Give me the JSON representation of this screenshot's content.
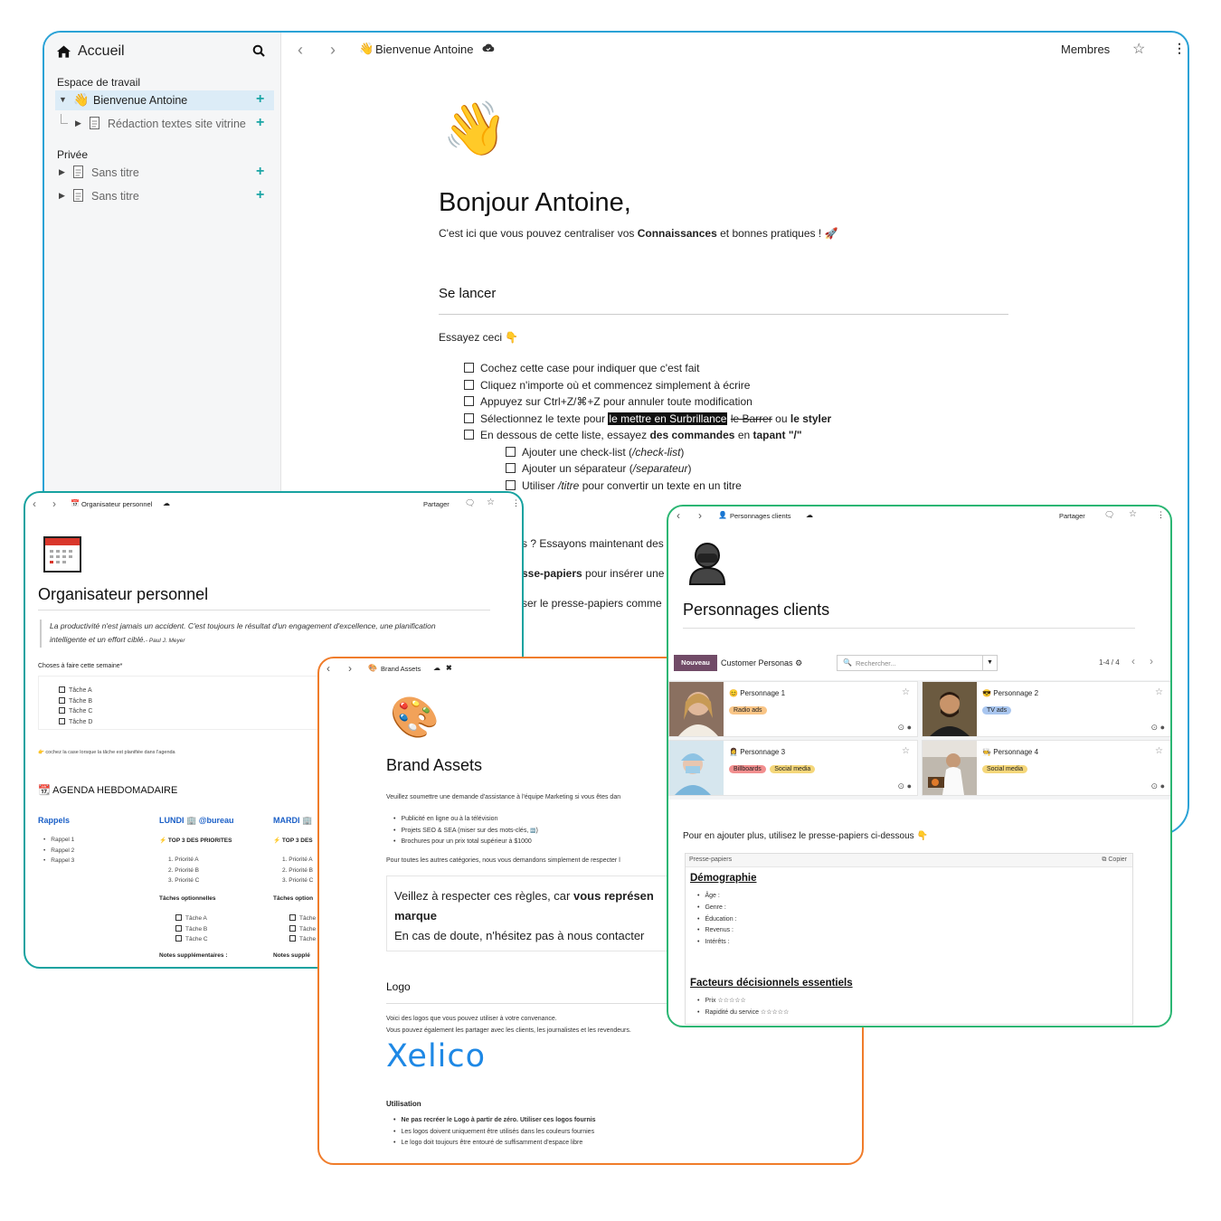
{
  "main": {
    "sidebar": {
      "home_label": "Accueil",
      "workspace_heading": "Espace de travail",
      "workspace_items": [
        {
          "label": "Bienvenue Antoine"
        },
        {
          "label": "Rédaction textes site vitrine"
        }
      ],
      "private_heading": "Privée",
      "private_items": [
        {
          "label": "Sans titre"
        },
        {
          "label": "Sans titre"
        }
      ]
    },
    "topbar": {
      "breadcrumb": "Bienvenue Antoine",
      "members_label": "Membres"
    },
    "doc": {
      "title": "Bonjour Antoine,",
      "intro_pre": "C'est ici que vous pouvez centraliser vos ",
      "intro_bold": "Connaissances",
      "intro_post": " et bonnes pratiques !",
      "section_title": "Se lancer",
      "try_label": "Essayez ceci",
      "checklist": [
        "Cochez cette case pour indiquer que c'est fait",
        "Cliquez n'importe où et commencez simplement à écrire",
        "Appuyez sur Ctrl+Z/⌘+Z pour annuler toute modification"
      ],
      "select_pre": "Sélectionnez le texte pour ",
      "select_highlight": "le mettre en Surbrillance",
      "select_strike": "le Barrer",
      "select_or": " ou ",
      "select_bold": "le styler",
      "below_pre": "En dessous de cette liste, essayez ",
      "below_bold1": "des commandes",
      "below_mid": " en ",
      "below_bold2": "tapant \"/\"",
      "sub_items": [
        {
          "pre": "Ajouter une check-list (",
          "em": "/check-list",
          "post": ")"
        },
        {
          "pre": "Ajouter un séparateur (",
          "em": "/separateur",
          "post": ")"
        },
        {
          "pre": "Utiliser ",
          "em": "/titre",
          "post": " pour convertir un texte en un titre"
        }
      ],
      "partial_1": "s ? Essayons maintenant des",
      "partial_2_bold": "sse-papiers",
      "partial_2": " pour insérer une",
      "partial_3": "ser le presse-papiers comme"
    }
  },
  "organisateur": {
    "breadcrumb": "Organisateur personnel",
    "share_label": "Partager",
    "title": "Organisateur personnel",
    "quote": "La productivité n'est jamais un accident. C'est toujours le résultat d'un engagement d'excellence, une planification intelligente et un effort ciblé.",
    "quote_author": "- Paul J. Meyer",
    "tasks_heading": "Choses à faire cette semaine*",
    "tasks": [
      "Tâche A",
      "Tâche B",
      "Tâche C",
      "Tâche D"
    ],
    "note": "cochez la case lorsque la tâche est planifiée dans l'agenda",
    "agenda_title": "AGENDA HEBDOMADAIRE",
    "reminders_heading": "Rappels",
    "reminders": [
      "Rappel 1",
      "Rappel 2",
      "Rappel 3"
    ],
    "day1": "LUNDI",
    "day1_tag": "@bureau",
    "day2": "MARDI",
    "top3": "TOP 3 DES PRIORITES",
    "top3_partial": "TOP 3 DES",
    "priorities": [
      "Priorité A",
      "Priorité B",
      "Priorité C"
    ],
    "optional_heading": "Tâches optionnelles",
    "optional_partial": "Tâches option",
    "optional": [
      "Tâche A",
      "Tâche B",
      "Tâche C"
    ],
    "optional_trunc": [
      "Tâche",
      "Tâche",
      "Tâche"
    ],
    "notes_heading": "Notes supplémentaires :",
    "notes_partial": "Notes supplé"
  },
  "brand": {
    "breadcrumb": "Brand Assets",
    "title": "Brand Assets",
    "intro": "Veuillez soumettre une demande d'assistance à l'équipe Marketing si vous êtes dan",
    "items": [
      "Publicité en ligne ou à la télévision",
      "Projets SEO & SEA (miser sur des mots-clés, ",
      "Brochures pour un prix total supérieur à $1000"
    ],
    "other": "Pour toutes les autres catégories, nous vous demandons simplement de respecter l",
    "callout_pre": "Veillez à respecter ces règles, car ",
    "callout_bold": "vous représen",
    "callout_bold2": "marque",
    "callout_line2": "En cas de doute, n'hésitez pas à nous contacter",
    "logo_heading": "Logo",
    "logo_text1": "Voici des logos que vous pouvez utiliser à votre convenance.",
    "logo_text2": "Vous pouvez également les partager avec les clients, les journalistes et les revendeurs.",
    "logo_word": "Xelico",
    "usage_heading": "Utilisation",
    "usage": [
      "Ne pas recréer le Logo à partir de zéro. Utiliser ces logos fournis",
      "Les logos doivent uniquement être utilisés dans les couleurs fournies",
      "Le logo doit toujours être entouré de suffisamment d'espace libre"
    ],
    "colors": {
      "logo": "#1e88e5"
    }
  },
  "personnages": {
    "breadcrumb": "Personnages clients",
    "share_label": "Partager",
    "title": "Personnages clients",
    "new_button": "Nouveau",
    "view_name": "Customer Personas",
    "search_placeholder": "Rechercher...",
    "pager": "1-4 / 4",
    "cards": [
      {
        "name": "Personnage 1",
        "tags": [
          "Radio ads"
        ]
      },
      {
        "name": "Personnage 2",
        "tags": [
          "TV ads"
        ]
      },
      {
        "name": "Personnage 3",
        "tags": [
          "Billboards",
          "Social media"
        ]
      },
      {
        "name": "Personnage 4",
        "tags": [
          "Social media"
        ]
      }
    ],
    "add_more": "Pour en ajouter plus, utilisez le presse-papiers ci-dessous",
    "clipboard_label": "Presse-papiers",
    "copy_label": "Copier",
    "demo_heading": "Démographie",
    "demo_items": [
      "Âge :",
      "Genre :",
      "Éducation :",
      "Revenus :",
      "Intérêts :"
    ],
    "factors_heading": "Facteurs décisionnels essentiels",
    "factors": [
      "Prix ☆☆☆☆☆",
      "Rapidité du service ☆☆☆☆☆"
    ]
  }
}
